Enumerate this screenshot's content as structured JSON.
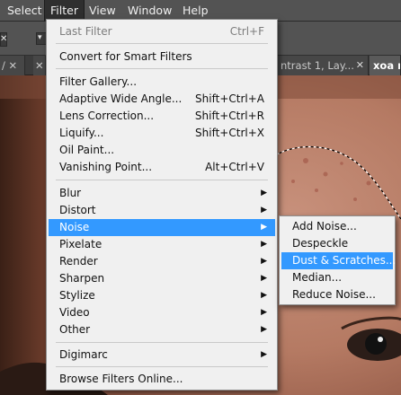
{
  "menubar": {
    "items": [
      {
        "label": "Select"
      },
      {
        "label": "Filter"
      },
      {
        "label": "View"
      },
      {
        "label": "Window"
      },
      {
        "label": "Help"
      }
    ]
  },
  "tabs": [
    {
      "label": "/ ✕"
    },
    {
      "label": "ntrast 1, Lay..."
    },
    {
      "label": "xoa m"
    }
  ],
  "filter_menu": {
    "items": [
      {
        "label": "Last Filter",
        "shortcut": "Ctrl+F",
        "disabled": true
      },
      {
        "label": "Convert for Smart Filters"
      },
      {
        "label": "Filter Gallery..."
      },
      {
        "label": "Adaptive Wide Angle...",
        "shortcut": "Shift+Ctrl+A"
      },
      {
        "label": "Lens Correction...",
        "shortcut": "Shift+Ctrl+R"
      },
      {
        "label": "Liquify...",
        "shortcut": "Shift+Ctrl+X"
      },
      {
        "label": "Oil Paint..."
      },
      {
        "label": "Vanishing Point...",
        "shortcut": "Alt+Ctrl+V"
      },
      {
        "label": "Blur",
        "submenu": true
      },
      {
        "label": "Distort",
        "submenu": true
      },
      {
        "label": "Noise",
        "submenu": true,
        "highlighted": true
      },
      {
        "label": "Pixelate",
        "submenu": true
      },
      {
        "label": "Render",
        "submenu": true
      },
      {
        "label": "Sharpen",
        "submenu": true
      },
      {
        "label": "Stylize",
        "submenu": true
      },
      {
        "label": "Video",
        "submenu": true
      },
      {
        "label": "Other",
        "submenu": true
      },
      {
        "label": "Digimarc",
        "submenu": true
      },
      {
        "label": "Browse Filters Online..."
      }
    ]
  },
  "noise_submenu": {
    "items": [
      {
        "label": "Add Noise..."
      },
      {
        "label": "Despeckle"
      },
      {
        "label": "Dust & Scratches...",
        "highlighted": true
      },
      {
        "label": "Median..."
      },
      {
        "label": "Reduce Noise..."
      }
    ]
  },
  "colors": {
    "highlight": "#3399ff",
    "menu_bg": "#f0f0f0",
    "menubar_bg": "#535353"
  }
}
